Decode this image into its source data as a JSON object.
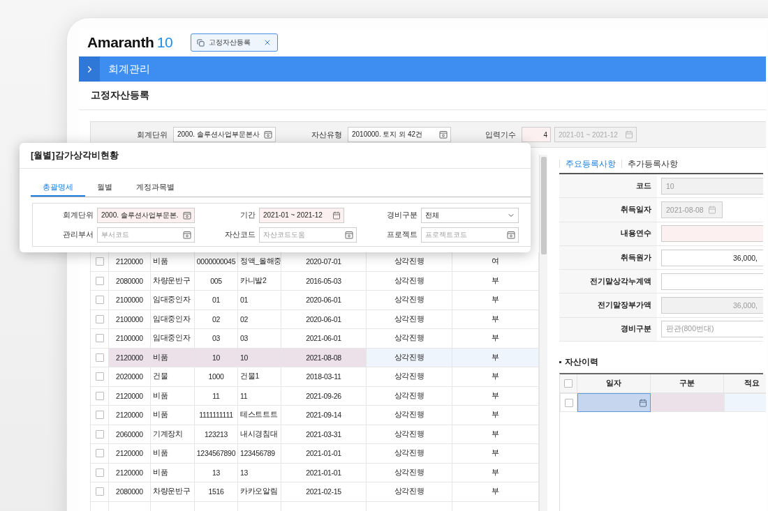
{
  "logo": {
    "name": "Amaranth",
    "version": "10"
  },
  "open_tabs": [
    {
      "label": "고정자산등록",
      "selected": true
    }
  ],
  "menu_bar": {
    "title": "회계관리"
  },
  "page_title": "고정자산등록",
  "filters": [
    {
      "label": "회계단위",
      "value": "2000. 솔루션사업부문본사",
      "kind": "code",
      "required": false,
      "disabled": false
    },
    {
      "label": "자산유형",
      "value": "2010000. 토지 외 42건",
      "kind": "code",
      "required": false,
      "disabled": false
    },
    {
      "label": "입력기수",
      "value": "4",
      "kind": "count",
      "required": true,
      "disabled": false
    },
    {
      "value": "2021-01 ~ 2021-12",
      "kind": "date",
      "required": false,
      "disabled": true
    }
  ],
  "asset_table": {
    "rows": [
      {
        "checked": false,
        "selected": false,
        "cells": [
          "2120000",
          "비품",
          "0000000045",
          "정액_올해중",
          "2020-07-01",
          "상각진행",
          "여"
        ]
      },
      {
        "checked": false,
        "selected": false,
        "cells": [
          "2080000",
          "차량운반구",
          "005",
          "카니발2",
          "2016-05-03",
          "상각진행",
          "부"
        ]
      },
      {
        "checked": false,
        "selected": false,
        "cells": [
          "2100000",
          "임대중인자",
          "01",
          "01",
          "2020-06-01",
          "상각진행",
          "부"
        ]
      },
      {
        "checked": false,
        "selected": false,
        "cells": [
          "2100000",
          "임대중인자",
          "02",
          "02",
          "2020-06-01",
          "상각진행",
          "부"
        ]
      },
      {
        "checked": false,
        "selected": false,
        "cells": [
          "2100000",
          "임대중인자",
          "03",
          "03",
          "2021-06-01",
          "상각진행",
          "부"
        ]
      },
      {
        "checked": false,
        "selected": true,
        "cells": [
          "2120000",
          "비품",
          "10",
          "10",
          "2021-08-08",
          "상각진행",
          "부"
        ]
      },
      {
        "checked": false,
        "selected": false,
        "cells": [
          "2020000",
          "건물",
          "1000",
          "건물1",
          "2018-03-11",
          "상각진행",
          "부"
        ]
      },
      {
        "checked": false,
        "selected": false,
        "cells": [
          "2120000",
          "비품",
          "11",
          "11",
          "2021-09-26",
          "상각진행",
          "부"
        ]
      },
      {
        "checked": false,
        "selected": false,
        "cells": [
          "2120000",
          "비품",
          "1111111111",
          "테스트트트",
          "2021-09-14",
          "상각진행",
          "부"
        ]
      },
      {
        "checked": false,
        "selected": false,
        "cells": [
          "2060000",
          "기계장치",
          "123213",
          "내시경침대",
          "2021-03-31",
          "상각진행",
          "부"
        ]
      },
      {
        "checked": false,
        "selected": false,
        "cells": [
          "2120000",
          "비품",
          "1234567890",
          "123456789",
          "2021-01-01",
          "상각진행",
          "부"
        ]
      },
      {
        "checked": false,
        "selected": false,
        "cells": [
          "2120000",
          "비품",
          "13",
          "13",
          "2021-01-01",
          "상각진행",
          "부"
        ]
      },
      {
        "checked": false,
        "selected": false,
        "cells": [
          "2080000",
          "차량운반구",
          "1516",
          "카카오알림",
          "2021-02-15",
          "상각진행",
          "부"
        ]
      }
    ]
  },
  "detail_tabs": [
    {
      "label": "주요등록사항",
      "selected": true
    },
    {
      "label": "추가등록사항",
      "selected": false
    }
  ],
  "detail_fields": [
    {
      "label": "코드",
      "value": "10",
      "kind": "text",
      "disabled": true,
      "required": false
    },
    {
      "label": "취득일자",
      "value": "2021-08-08",
      "kind": "date",
      "disabled": true,
      "required": false
    },
    {
      "label": "내용연수",
      "kind": "text",
      "disabled": false,
      "required": true
    },
    {
      "label": "취득원가",
      "value": "36,000,",
      "kind": "amount",
      "disabled": false,
      "required": false
    },
    {
      "label": "전기말상각누계액",
      "kind": "amount",
      "disabled": false,
      "required": false
    },
    {
      "label": "전기말장부가액",
      "value": "36,000,",
      "kind": "amount",
      "disabled": true,
      "required": false
    },
    {
      "label": "경비구분",
      "placeholder": "판관(800번대)",
      "kind": "text",
      "disabled": false,
      "required": false
    }
  ],
  "history": {
    "title": "자산이력",
    "all_checked": false,
    "columns": [
      "일자",
      "구분",
      "적요"
    ],
    "rows": [
      {
        "checked": false
      }
    ]
  },
  "popup": {
    "title": "[월별]감가상각비현황",
    "tabs": [
      {
        "label": "총괄명세",
        "selected": true
      },
      {
        "label": "월별",
        "selected": false
      },
      {
        "label": "계정과목별",
        "selected": false
      }
    ],
    "filters": [
      {
        "label": "회계단위",
        "value": "2000. 솔루션사업부문본.",
        "kind": "code",
        "required": true
      },
      {
        "label": "기간",
        "value": "2021-01 ~ 2021-12",
        "kind": "date",
        "required": true
      },
      {
        "label": "경비구분",
        "value": "전체",
        "kind": "select",
        "required": false
      },
      {
        "label": "관리부서",
        "placeholder": "부서코드",
        "kind": "code",
        "required": false
      },
      {
        "label": "자산코드",
        "placeholder": "자산코드도움",
        "kind": "code",
        "required": false
      },
      {
        "label": "프로젝트",
        "placeholder": "프로젝트코드",
        "kind": "code",
        "required": false
      }
    ]
  }
}
